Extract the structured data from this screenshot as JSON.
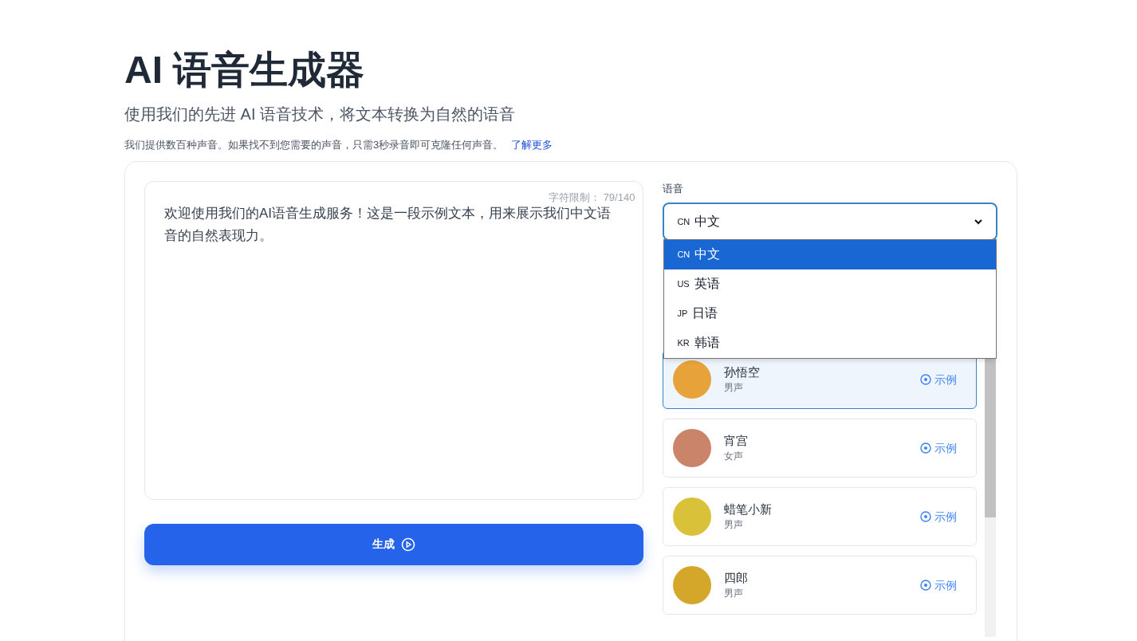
{
  "header": {
    "title": "AI 语音生成器",
    "subtitle": "使用我们的先进 AI 语音技术，将文本转换为自然的语音",
    "note": "我们提供数百种声音。如果找不到您需要的声音，只需3秒录音即可克隆任何声音。",
    "note_link": "了解更多"
  },
  "editor": {
    "char_limit": "字符限制： 79/140",
    "value": "欢迎使用我们的AI语音生成服务！这是一段示例文本，用来展示我们中文语音的自然表现力。"
  },
  "generate_button": "生成",
  "language": {
    "label": "语音",
    "code": "CN",
    "value": "中文",
    "options": [
      {
        "code": "CN",
        "label": "中文",
        "selected": true
      },
      {
        "code": "US",
        "label": "英语",
        "selected": false
      },
      {
        "code": "JP",
        "label": "日语",
        "selected": false
      },
      {
        "code": "KR",
        "label": "韩语",
        "selected": false
      }
    ]
  },
  "voices": [
    {
      "name": "孙悟空",
      "gender": "男声",
      "sample": "示例",
      "selected": true,
      "color": "#e8a23a"
    },
    {
      "name": "宵宫",
      "gender": "女声",
      "sample": "示例",
      "selected": false,
      "color": "#c9846a"
    },
    {
      "name": "蜡笔小新",
      "gender": "男声",
      "sample": "示例",
      "selected": false,
      "color": "#d9c23a"
    },
    {
      "name": "四郎",
      "gender": "男声",
      "sample": "示例",
      "selected": false,
      "color": "#d4a62a"
    }
  ]
}
